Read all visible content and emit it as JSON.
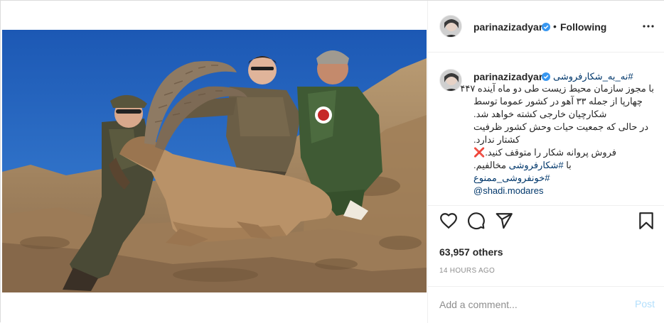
{
  "header": {
    "username": "parinazizadyar",
    "separator": "•",
    "follow_status": "Following",
    "more_icon": "more-horizontal-icon"
  },
  "caption": {
    "username": "parinazizadyar",
    "hashtag_first": "#نه_به_شکارفروشی",
    "lines": [
      "با مجوز سازمان محیط زیست طی دو ماه آینده ۴۴۷",
      "چهارپا از جمله ۳۳ آهو در کشور عموما توسط",
      "شکارچیان خارجی کشته خواهد شد.",
      "در حالی که جمعیت حیات وحش کشور ظرفیت",
      "کشتار ندارد."
    ],
    "line_stop": "فروش پروانه شکار را متوقف کنید.",
    "cross_emoji": "❌",
    "line_oppose_prefix": "با ",
    "line_oppose_tag": "#شکارفروشی",
    "line_oppose_suffix": " مخالفیم.",
    "tag_ban": "#خونفروشی_ممنوع",
    "mention": "@shadi.modares"
  },
  "actions": {
    "like_icon": "heart-icon",
    "comment_icon": "comment-icon",
    "share_icon": "paper-plane-icon",
    "save_icon": "bookmark-icon"
  },
  "likes": {
    "count": "63,957 others"
  },
  "timestamp": "14 HOURS AGO",
  "comment": {
    "placeholder": "Add a comment...",
    "post_label": "Post"
  },
  "colors": {
    "link": "#00376b",
    "verified": "#3897f0",
    "post_disabled": "#b2dffc",
    "muted": "#8e8e8e"
  }
}
